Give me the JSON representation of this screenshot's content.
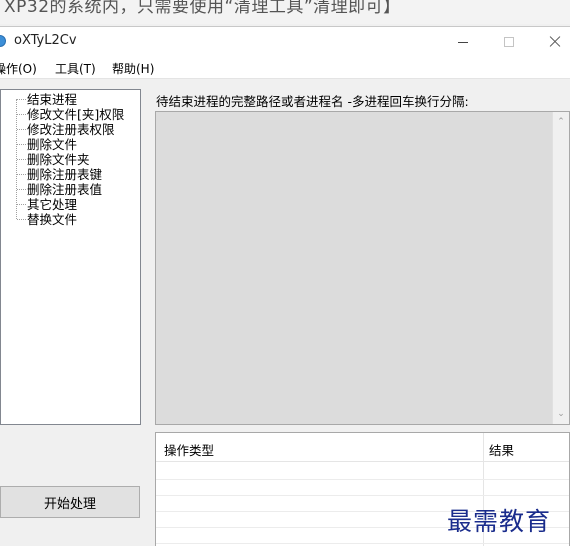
{
  "top_strip": {
    "text": "XP32的系统内，只需要使用“清理工具”清理即可】"
  },
  "window": {
    "title": "oXTyL2Cv",
    "controls": {
      "minimize": "minimize",
      "maximize": "maximize",
      "close": "close"
    }
  },
  "menu": {
    "items": [
      {
        "label": "操作(O)"
      },
      {
        "label": "工具(T)"
      },
      {
        "label": "帮助(H)"
      }
    ]
  },
  "tree": {
    "items": [
      {
        "label": "结束进程"
      },
      {
        "label": "修改文件[夹]权限"
      },
      {
        "label": "修改注册表权限"
      },
      {
        "label": "删除文件"
      },
      {
        "label": "删除文件夹"
      },
      {
        "label": "删除注册表键"
      },
      {
        "label": "删除注册表值"
      },
      {
        "label": "其它处理"
      },
      {
        "label": "替换文件"
      }
    ]
  },
  "instruction": "待结束进程的完整路径或者进程名 -多进程回车换行分隔:",
  "process_input": {
    "value": ""
  },
  "buttons": {
    "start": "开始处理"
  },
  "results": {
    "columns": [
      "操作类型",
      "结果"
    ],
    "rows": []
  },
  "watermark": "最需教育"
}
